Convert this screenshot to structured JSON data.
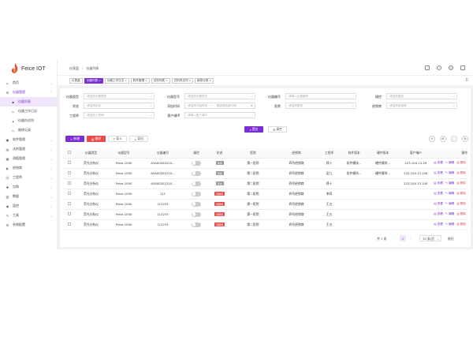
{
  "brand": {
    "name": "Feice IOT",
    "color": "#7b2fd0"
  },
  "sidebar": {
    "items": [
      {
        "icon": "home-icon",
        "glyph": "⌂",
        "label": "首页",
        "arrow": "⌄"
      },
      {
        "icon": "instrument-icon",
        "glyph": "⚙",
        "label": "仪器管理",
        "arrow": "⌃"
      },
      {
        "icon": "list-icon",
        "glyph": "▪",
        "label": "仪器列表",
        "sub": true,
        "active": true
      },
      {
        "icon": "doc-icon",
        "glyph": "▫",
        "label": "仪器工作日志",
        "sub": true
      },
      {
        "icon": "task-icon",
        "glyph": "▴",
        "label": "仪器内试列",
        "sub": true
      },
      {
        "icon": "record-icon",
        "glyph": "▫",
        "label": "维修记录",
        "sub": true
      },
      {
        "icon": "software-icon",
        "glyph": "▣",
        "label": "软件管理",
        "arrow": "⌄"
      },
      {
        "icon": "trial-icon",
        "glyph": "▤",
        "label": "试剂管理",
        "arrow": "⌄"
      },
      {
        "icon": "kit-icon",
        "glyph": "▦",
        "label": "测值管理",
        "arrow": "⌄"
      },
      {
        "icon": "dealer-icon",
        "glyph": "◐",
        "label": "经销商",
        "arrow": "⌄"
      },
      {
        "icon": "engineer-icon",
        "glyph": "☺",
        "label": "工程师",
        "arrow": "⌄"
      },
      {
        "icon": "hospital-icon",
        "glyph": "✚",
        "label": "包购",
        "arrow": "⌄"
      },
      {
        "icon": "data-icon",
        "glyph": "▥",
        "label": "数据",
        "arrow": "⌄"
      },
      {
        "icon": "monitor-icon",
        "glyph": "◉",
        "label": "监控",
        "arrow": "⌄"
      },
      {
        "icon": "tools-icon",
        "glyph": "✎",
        "label": "工具",
        "arrow": "⌄"
      },
      {
        "icon": "settings-icon",
        "glyph": "⚙",
        "label": "系统配置"
      }
    ]
  },
  "topbar": {
    "breadcrumb": [
      "仪表盘",
      "仪器列表"
    ]
  },
  "tabs": [
    {
      "label": "仪表盘",
      "closable": false
    },
    {
      "label": "仪器列表",
      "closable": true,
      "active": true
    },
    {
      "label": "仪器工作日志",
      "closable": true
    },
    {
      "label": "软件管理",
      "closable": true
    },
    {
      "label": "试剂列表",
      "closable": true
    },
    {
      "label": "试剂内试列",
      "closable": true
    },
    {
      "label": "维修记录",
      "closable": true
    }
  ],
  "filters": {
    "row1": [
      {
        "label": "仪器类型",
        "placeholder": "请选择仪器类型",
        "dropdown": true
      },
      {
        "label": "仪器型号",
        "placeholder": "请选择仪器型号",
        "dropdown": true
      },
      {
        "label": "仪器编号",
        "placeholder": "请输入仪器编号",
        "dropdown": false
      },
      {
        "label": "操控",
        "placeholder": "请选择操控",
        "dropdown": true
      }
    ],
    "row2": [
      {
        "label": "状态",
        "placeholder": "请选择状态",
        "dropdown": true
      },
      {
        "label": "添加时间",
        "placeholder": "请选择开始时间",
        "range_sep": "~",
        "placeholder2": "请选择结束时间"
      },
      {
        "label": "医院",
        "placeholder": "请选择医院",
        "dropdown": true
      },
      {
        "label": "经销商",
        "placeholder": "请选择经销商",
        "dropdown": true
      }
    ],
    "row3": [
      {
        "label": "工程师",
        "placeholder": "请选择工程师",
        "dropdown": true
      },
      {
        "label": "客户端IP",
        "placeholder": "请输入客户端IP",
        "dropdown": false
      }
    ],
    "submit_label": "提交",
    "reset_label": "清空"
  },
  "toolbar": {
    "add_label": "新增",
    "delete_label": "删除",
    "import_label": "导入",
    "export_label": "导出"
  },
  "table": {
    "columns": [
      "",
      "仪器类型",
      "仪器型号",
      "仪器编号",
      "操控",
      "状态",
      "医院",
      "经销商",
      "工程师",
      "软件版本",
      "硬件版本",
      "客户端IP",
      "操作"
    ],
    "rows": [
      [
        "荧光分析仪",
        "Feice-1000",
        "A3A00202210...",
        "",
        "离线",
        "第一医院",
        "四号经销商",
        "郑十",
        "软件模块...",
        "硬件模块...",
        "223.104.13.29"
      ],
      [
        "荧光分析仪",
        "Feice-1000",
        "A3A00202210...",
        "",
        "离线",
        "第二医院",
        "四号经销商",
        "吴九",
        "软件模块...",
        "硬件模块...",
        "223.104.13.140"
      ],
      [
        "荧光分析仪",
        "Feice-1000",
        "A3A00202210...",
        "",
        "离线",
        "第二医院",
        "四号经销商",
        "郑十",
        "",
        "",
        "223.104.13.140"
      ],
      [
        "荧光分析仪",
        "Feice-1000",
        "111",
        "",
        "待审核",
        "第二医院",
        "四号经销商",
        "李四",
        "",
        "",
        ""
      ],
      [
        "荧光分析仪",
        "Feice-1000",
        "112233",
        "",
        "待审核",
        "第一医院",
        "四号经销商",
        "王五",
        "",
        "",
        ""
      ],
      [
        "荧光分析仪",
        "Feice-1000",
        "112233",
        "",
        "待审核",
        "第一医院",
        "四号经销商",
        "王五",
        "",
        "",
        ""
      ],
      [
        "荧光分析仪",
        "Feice-1000",
        "112233",
        "",
        "待审核",
        "第二医院",
        "四号经销商",
        "王五",
        "",
        "",
        ""
      ]
    ],
    "ops": {
      "view": "查看",
      "edit": "编辑",
      "delete": "删除"
    }
  },
  "pager": {
    "total": "共 7 条",
    "prev": "‹",
    "current": "1",
    "next": "›",
    "page_size": "10 条/页",
    "goto": "前往"
  }
}
